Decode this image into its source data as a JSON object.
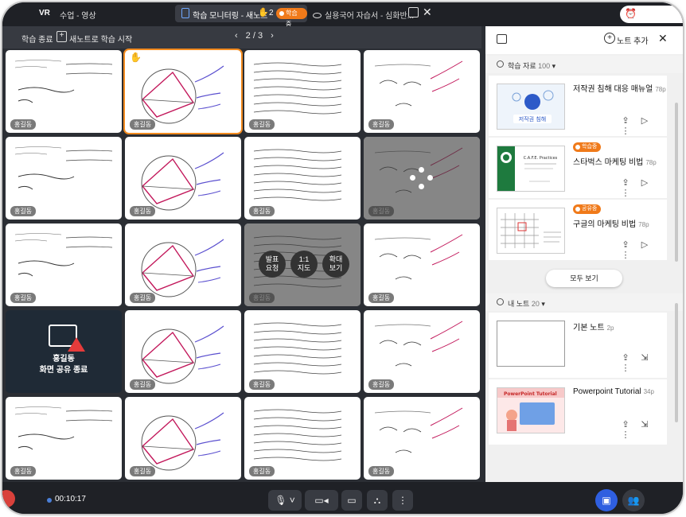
{
  "topbar": {
    "logo": "VR",
    "breadcrumb": "수업 - 영상",
    "active_tab": {
      "label": "학습 모니터링 - 새노트",
      "hand_count": "2",
      "badge": "학습중"
    },
    "second_tab": {
      "label": "실용국어 자습서 - 심화반..."
    }
  },
  "toolbar": {
    "end_label": "학습 종료",
    "new_note_label": "새노트로 학습 시작",
    "page_indicator": "2 / 3",
    "prev": "‹",
    "next": "›"
  },
  "grid": {
    "student_name": "홍길동",
    "share_end_line1": "홍길동",
    "share_end_line2": "화면 공유 종료",
    "actions": {
      "present": "발표\n요청",
      "one_on_one": "1:1\n지도",
      "zoom": "확대\n보기"
    },
    "action_present_1": "발표",
    "action_present_2": "요청",
    "action_1on1_1": "1:1",
    "action_1on1_2": "지도",
    "action_zoom_1": "확대",
    "action_zoom_2": "보기"
  },
  "panel": {
    "add_note_label": "노트 추가",
    "materials_header": "학습 자료",
    "materials_count": "100",
    "materials": [
      {
        "title": "저작권 침해 대응 매뉴얼",
        "pages": "78p",
        "tag": ""
      },
      {
        "title": "스타벅스 마케팅 비법",
        "pages": "78p",
        "tag": "학습중"
      },
      {
        "title": "구글의 마케팅 비법",
        "pages": "78p",
        "tag": "공유중"
      }
    ],
    "view_all_label": "모두 보기",
    "notes_header": "내 노트",
    "notes_count": "20",
    "notes": [
      {
        "title": "기본 노트",
        "pages": "2p"
      },
      {
        "title": "Powerpoint Tutorial",
        "pages": "34p"
      }
    ],
    "thumb_texts": {
      "copyright": "저작권 침해",
      "ppt": "PowerPoint Tutorial",
      "starbucks": "C.A.F.E. Practices"
    }
  },
  "bottombar": {
    "elapsed": "00:10:17"
  },
  "colors": {
    "accent": "#f07a1a",
    "primary": "#2f5fe0",
    "bg_dark": "#2b2e34"
  }
}
